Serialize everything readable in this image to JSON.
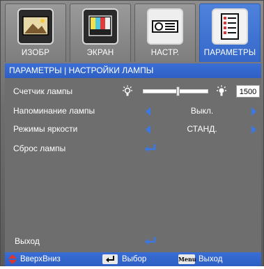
{
  "tabs": [
    {
      "label": "ИЗОБР",
      "icon": "picture-icon"
    },
    {
      "label": "ЭКРАН",
      "icon": "color-bars-icon"
    },
    {
      "label": "НАСТР.",
      "icon": "projector-icon"
    },
    {
      "label": "ПАРАМЕТРЫ",
      "icon": "settings-list-icon"
    }
  ],
  "active_tab": "ПАРАМЕТРЫ",
  "header": {
    "title": "ПАРАМЕТРЫ | НАСТРОЙКИ ЛАМПЫ"
  },
  "menu": {
    "lamp_hours": {
      "label": "Счетчик лампы",
      "value": "1500",
      "slider_level": 0.54
    },
    "lamp_reminder": {
      "label": "Напоминание лампы",
      "value": "Выкл."
    },
    "brightness_mode": {
      "label": "Режимы яркости",
      "value": "СТАНД."
    },
    "lamp_reset": {
      "label": "Сброс лампы"
    },
    "exit": {
      "label": "Выход"
    }
  },
  "footer": {
    "updown_label": "ВверхВниз",
    "select_label": "Выбор",
    "menu_key": "Menu",
    "exit_label": "Выход"
  },
  "colors": {
    "accent": "#3b6fd6",
    "panel": "#6e6e6e",
    "arrow": "#3b78e7"
  }
}
